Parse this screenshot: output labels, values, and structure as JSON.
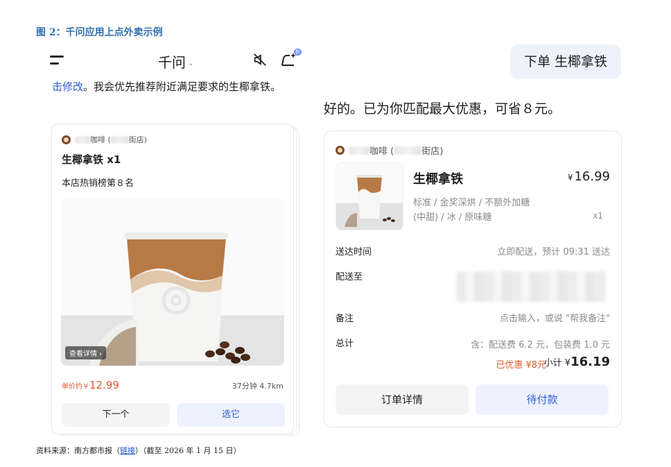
{
  "figure": {
    "title": "图 2：千问应用上点外卖示例",
    "source_prefix": "资料来源：南方都市报（",
    "source_link": "链接",
    "source_suffix": "）（截至 2026 年 1 月 15 日）"
  },
  "left_screen": {
    "app_title": "千问",
    "chevron": "⌄",
    "new_badge": "新",
    "prev_text_link": "击修改",
    "prev_text_rest": "。我会优先推荐附近满足要求的生椰拿铁。",
    "card": {
      "shop_name_mid": "咖啡 (",
      "shop_name_end": "街店)",
      "product": "生椰拿铁 x1",
      "rank": "本店热销榜第８名",
      "details_tag": "查看详情 ›",
      "price_prefix": "单价约￥",
      "price": "12.99",
      "eta": "37分钟 4.7km",
      "next_button": "下一个",
      "select_button": "选它"
    }
  },
  "right_screen": {
    "user_message": "下单 生椰拿铁",
    "reply": "好的。已为你匹配最大优惠，可省８元。",
    "order": {
      "shop_name_mid": "咖啡 (",
      "shop_name_end": "街店)",
      "product": "生椰拿铁",
      "currency": "¥",
      "price": "16.99",
      "spec_line1": "标准 / 金奖深烘 / 不额外加糖",
      "spec_line2": "(中甜) / 冰 / 原味糖",
      "qty": "x1",
      "delivery_time_label": "送达时间",
      "delivery_time_value": "立即配送，预计 09:31 送达",
      "deliver_to_label": "配送至",
      "note_label": "备注",
      "note_value": "点击输入，或说 \"帮我备注\"",
      "total_label": "总计",
      "total_fees": "含：配送费 6.2 元，包装费 1.0 元",
      "discount": "已优惠 ¥8元",
      "subtotal_label": "小计 ¥",
      "subtotal": "16.19",
      "detail_button": "订单详情",
      "pay_button": "待付款"
    }
  },
  "colors": {
    "accent_blue": "#2f5bd3",
    "price_orange": "#e05a2b",
    "figure_title": "#2f6fb0"
  },
  "icons": [
    "menu-icon",
    "chevron-down-icon",
    "mute-icon",
    "new-chat-icon",
    "shop-avatar-icon",
    "chevron-right-icon"
  ]
}
